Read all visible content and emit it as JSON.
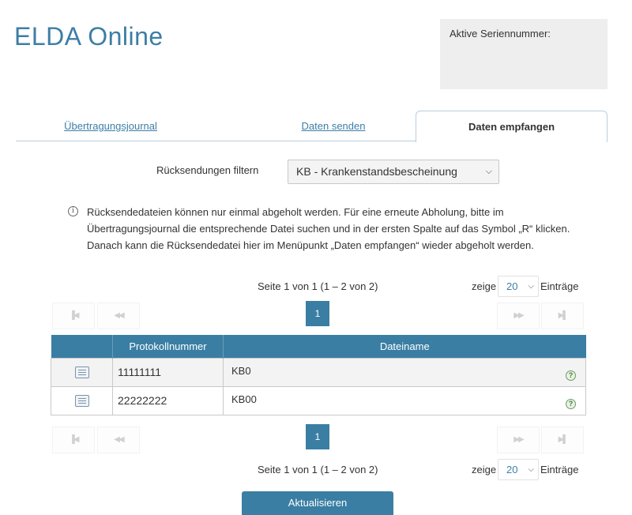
{
  "app": {
    "title": "ELDA Online"
  },
  "serial": {
    "label": "Aktive Seriennummer:"
  },
  "tabs": [
    {
      "label": "Übertragungsjournal"
    },
    {
      "label": "Daten senden"
    },
    {
      "label": "Daten empfangen"
    }
  ],
  "filter": {
    "label": "Rücksendungen filtern",
    "selected": "KB - Krankenstandsbescheinung"
  },
  "info": {
    "line1": "Rücksendedateien können nur einmal abgeholt werden. Für eine erneute Abholung, bitte im",
    "line2": "Übertragungsjournal die entsprechende Datei suchen und in der ersten Spalte auf das Symbol „R“ klicken.",
    "line3": "Danach kann die Rücksendedatei hier im Menüpunkt „Daten empfangen“ wieder abgeholt werden."
  },
  "pager": {
    "page_info": "Seite 1 von 1 (1 – 2 von 2)",
    "show_label": "zeige",
    "per_page": "20",
    "entries_label": "Einträge",
    "current_page": "1",
    "first": "▐◀",
    "prev": "◀◀",
    "next": "▶▶",
    "last": "▶▌"
  },
  "table": {
    "headers": [
      "",
      "Protokollnummer",
      "Dateiname"
    ],
    "rows": [
      {
        "protokollnummer": "11111111",
        "dateiname": "KB0"
      },
      {
        "protokollnummer": "22222222",
        "dateiname": "KB00"
      }
    ],
    "help_glyph": "?"
  },
  "actions": {
    "refresh_label": "Aktualisieren"
  },
  "colors": {
    "accent": "#3a7ea3",
    "title": "#3d7ea6"
  },
  "icons": {
    "info": "info-icon",
    "document": "document-icon",
    "help": "help-icon"
  }
}
